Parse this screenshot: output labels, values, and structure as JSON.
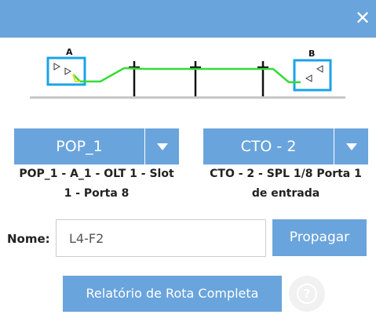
{
  "titlebar": {
    "close_icon": "close-icon"
  },
  "diagram": {
    "point_a_label": "A",
    "point_b_label": "B"
  },
  "origin": {
    "selected": "POP_1",
    "description_line1": "POP_1 - A_1 - OLT 1 - Slot",
    "description_line2": "1 - Porta 8"
  },
  "destination": {
    "selected": "CTO - 2",
    "description_line1": "CTO - 2 - SPL 1/8 Porta 1",
    "description_line2": "de entrada"
  },
  "form": {
    "name_label": "Nome:",
    "name_value": "L4-F2",
    "propagate_label": "Propagar"
  },
  "footer": {
    "report_label": "Relatório de Rota Completa",
    "help_glyph": "?"
  },
  "colors": {
    "accent": "#6aa4dc",
    "fiber": "#33dd33",
    "box": "#1aa3e8"
  }
}
